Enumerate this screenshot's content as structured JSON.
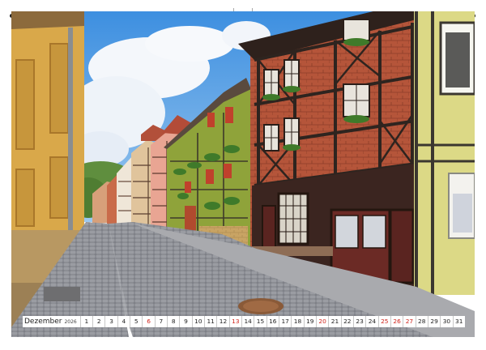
{
  "calendar": {
    "month": "Dezember",
    "year": "2026",
    "days": [
      {
        "n": "1",
        "sunday": false
      },
      {
        "n": "2",
        "sunday": false
      },
      {
        "n": "3",
        "sunday": false
      },
      {
        "n": "4",
        "sunday": false
      },
      {
        "n": "5",
        "sunday": false
      },
      {
        "n": "6",
        "sunday": true
      },
      {
        "n": "7",
        "sunday": false
      },
      {
        "n": "8",
        "sunday": false
      },
      {
        "n": "9",
        "sunday": false
      },
      {
        "n": "10",
        "sunday": false
      },
      {
        "n": "11",
        "sunday": false
      },
      {
        "n": "12",
        "sunday": false
      },
      {
        "n": "13",
        "sunday": true
      },
      {
        "n": "14",
        "sunday": false
      },
      {
        "n": "15",
        "sunday": false
      },
      {
        "n": "16",
        "sunday": false
      },
      {
        "n": "17",
        "sunday": false
      },
      {
        "n": "18",
        "sunday": false
      },
      {
        "n": "19",
        "sunday": false
      },
      {
        "n": "20",
        "sunday": true
      },
      {
        "n": "21",
        "sunday": false
      },
      {
        "n": "22",
        "sunday": false
      },
      {
        "n": "23",
        "sunday": false
      },
      {
        "n": "24",
        "sunday": false
      },
      {
        "n": "25",
        "sunday": true
      },
      {
        "n": "26",
        "sunday": true
      },
      {
        "n": "27",
        "sunday": true
      },
      {
        "n": "28",
        "sunday": false
      },
      {
        "n": "29",
        "sunday": false
      },
      {
        "n": "30",
        "sunday": false
      },
      {
        "n": "31",
        "sunday": false
      }
    ]
  },
  "colors": {
    "sunday": "#d0241c",
    "sky": "#3d8fe0",
    "timber": "#3a2a24",
    "brick": "#b5553a",
    "green_house": "#8fa33a",
    "yellow_house": "#dcd986"
  },
  "icons": [
    "spiral-binding",
    "hanger-notch"
  ]
}
